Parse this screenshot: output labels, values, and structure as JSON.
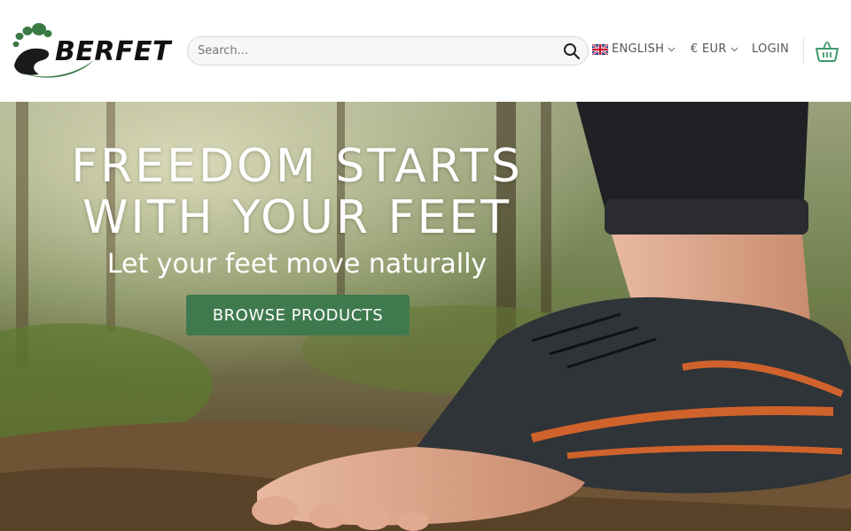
{
  "brand": {
    "logo_text": "BERFET",
    "accent_color": "#3f7a4e"
  },
  "header": {
    "search": {
      "placeholder": "Search...",
      "value": ""
    },
    "language": {
      "label": "ENGLISH",
      "flag": "uk-flag-icon"
    },
    "currency": {
      "label": "€ EUR"
    },
    "login_label": "LOGIN",
    "cart_icon": "basket-icon"
  },
  "hero": {
    "title_line1": "FREEDOM STARTS",
    "title_line2": "WITH YOUR FEET",
    "subtitle": "Let your feet move naturally",
    "cta_label": "BROWSE PRODUCTS"
  }
}
